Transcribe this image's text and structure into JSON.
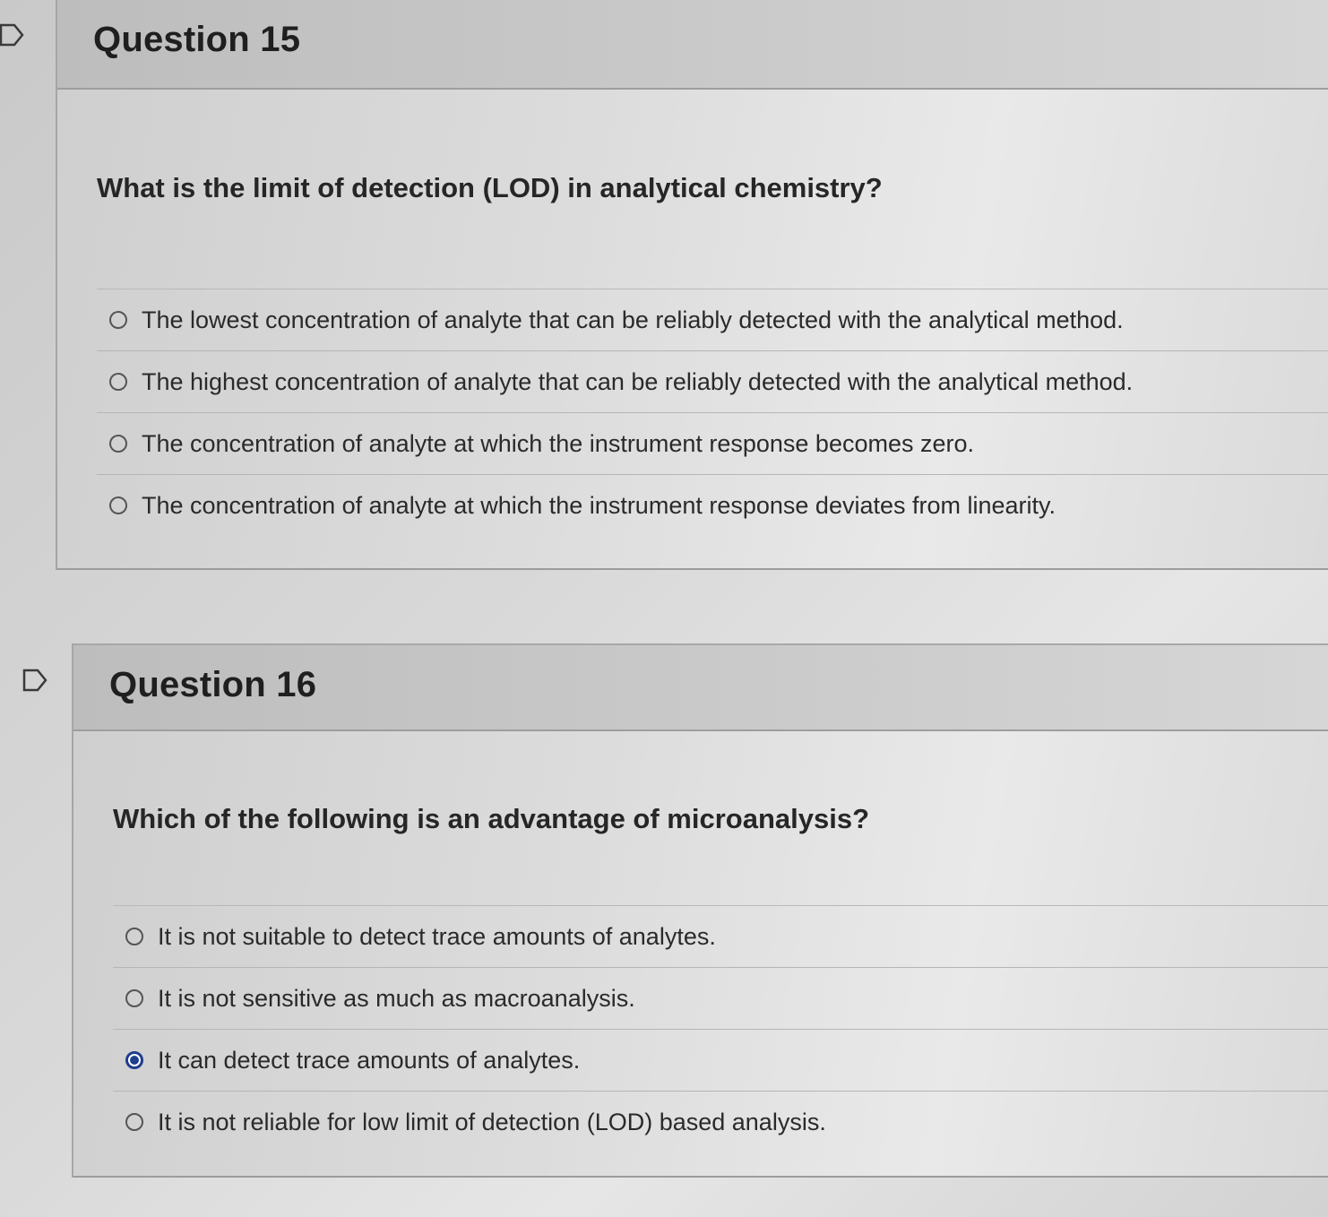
{
  "questions": [
    {
      "title": "Question 15",
      "text": "What is the limit of detection (LOD) in analytical chemistry?",
      "options": [
        "The lowest concentration of analyte that can be reliably detected with the analytical method.",
        "The highest concentration of analyte that can be reliably detected with the analytical method.",
        "The concentration of analyte at which the instrument response becomes zero.",
        "The concentration of analyte at which the instrument response deviates from linearity."
      ],
      "selected_index": null
    },
    {
      "title": "Question 16",
      "text": "Which of the following is an advantage of microanalysis?",
      "options": [
        "It is not suitable to detect trace amounts of analytes.",
        "It is not sensitive as much as macroanalysis.",
        "It can detect trace amounts of analytes.",
        "It is not reliable for low limit of detection (LOD) based analysis."
      ],
      "selected_index": 2
    }
  ],
  "icons": {
    "flag": "flag-icon",
    "radio_unselected": "radio-unselected-icon",
    "radio_selected": "radio-selected-icon"
  },
  "colors": {
    "selected_radio": "#1f3d8f",
    "header_background": "#c4c4c4",
    "body_background": "#dedede"
  }
}
